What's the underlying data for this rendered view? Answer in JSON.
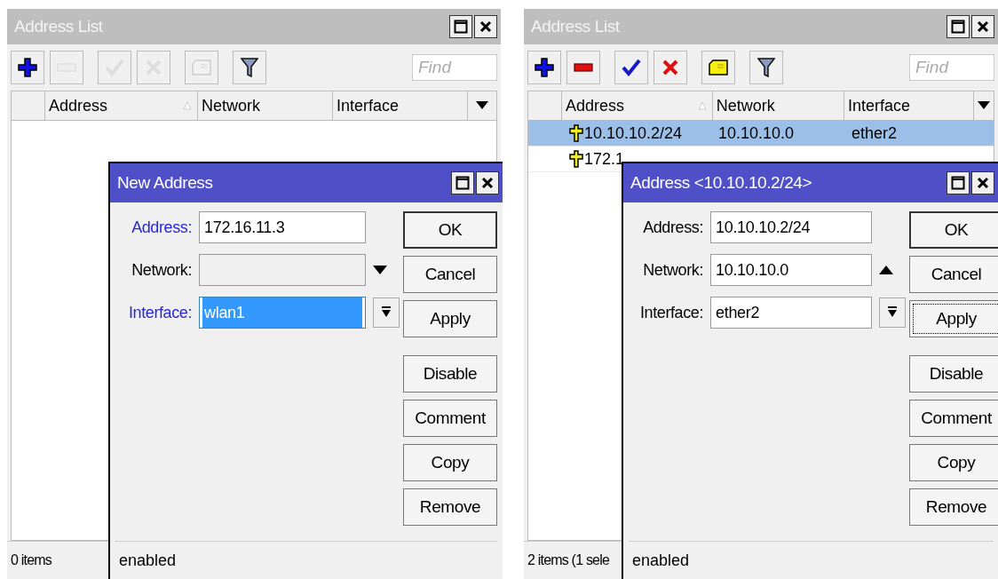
{
  "panes": [
    {
      "list": {
        "title": "Address List",
        "tools": [
          {
            "kind": "add",
            "disabled": false
          },
          {
            "kind": "remove",
            "disabled": true
          },
          {
            "kind": "enable",
            "disabled": true
          },
          {
            "kind": "disable",
            "disabled": true
          },
          {
            "kind": "comment",
            "disabled": true
          },
          {
            "kind": "filter",
            "disabled": false
          }
        ],
        "find_placeholder": "Find",
        "columns": [
          "Address",
          "Network",
          "Interface"
        ],
        "status": "0 items"
      },
      "dialog": {
        "title": "New Address",
        "fields": [
          {
            "kind": "text",
            "label": "Address:",
            "value": "172.16.11.3",
            "changed": true,
            "disabled": false,
            "selected": false
          },
          {
            "kind": "triangle-down",
            "label": "Network:",
            "changed": false,
            "disabled": true,
            "selected": false
          },
          {
            "kind": "dropdown",
            "label": "Interface:",
            "value": "wlan1",
            "changed": true,
            "disabled": false,
            "selected": true
          }
        ],
        "buttons": [
          {
            "label": "OK",
            "focused": false
          },
          {
            "label": "Cancel",
            "focused": false
          },
          {
            "label": "Apply",
            "focused": false
          },
          {
            "label": "Disable",
            "focused": false
          },
          {
            "label": "Comment",
            "focused": false
          },
          {
            "label": "Copy",
            "focused": false
          },
          {
            "label": "Remove",
            "focused": false
          }
        ],
        "status": "enabled"
      }
    },
    {
      "list": {
        "title": "Address List",
        "tools": [
          {
            "kind": "add",
            "disabled": false
          },
          {
            "kind": "remove",
            "disabled": false
          },
          {
            "kind": "enable",
            "disabled": false
          },
          {
            "kind": "disable",
            "disabled": false
          },
          {
            "kind": "comment",
            "disabled": false
          },
          {
            "kind": "filter",
            "disabled": false
          }
        ],
        "find_placeholder": "Find",
        "columns": [
          "Address",
          "Network",
          "Interface"
        ],
        "rows": [
          {
            "cells": [
              "10.10.10.2/24",
              "10.10.10.0",
              "ether2"
            ],
            "selected": true
          },
          {
            "cells": [
              "172.1"
            ],
            "selected": false
          }
        ],
        "status": "2 items (1 sele"
      },
      "dialog": {
        "title": "Address <10.10.10.2/24>",
        "fields": [
          {
            "kind": "text",
            "label": "Address:",
            "value": "10.10.10.2/24",
            "changed": false,
            "disabled": false,
            "selected": false
          },
          {
            "kind": "triangle-up",
            "label": "Network:",
            "value": "10.10.10.0",
            "changed": false,
            "disabled": false,
            "selected": false
          },
          {
            "kind": "dropdown",
            "label": "Interface:",
            "value": "ether2",
            "changed": false,
            "disabled": false,
            "selected": false
          }
        ],
        "buttons": [
          {
            "label": "OK",
            "focused": false
          },
          {
            "label": "Cancel",
            "focused": false
          },
          {
            "label": "Apply",
            "focused": true
          },
          {
            "label": "Disable",
            "focused": false
          },
          {
            "label": "Comment",
            "focused": false
          },
          {
            "label": "Copy",
            "focused": false
          },
          {
            "label": "Remove",
            "focused": false
          }
        ],
        "status": "enabled"
      }
    }
  ]
}
